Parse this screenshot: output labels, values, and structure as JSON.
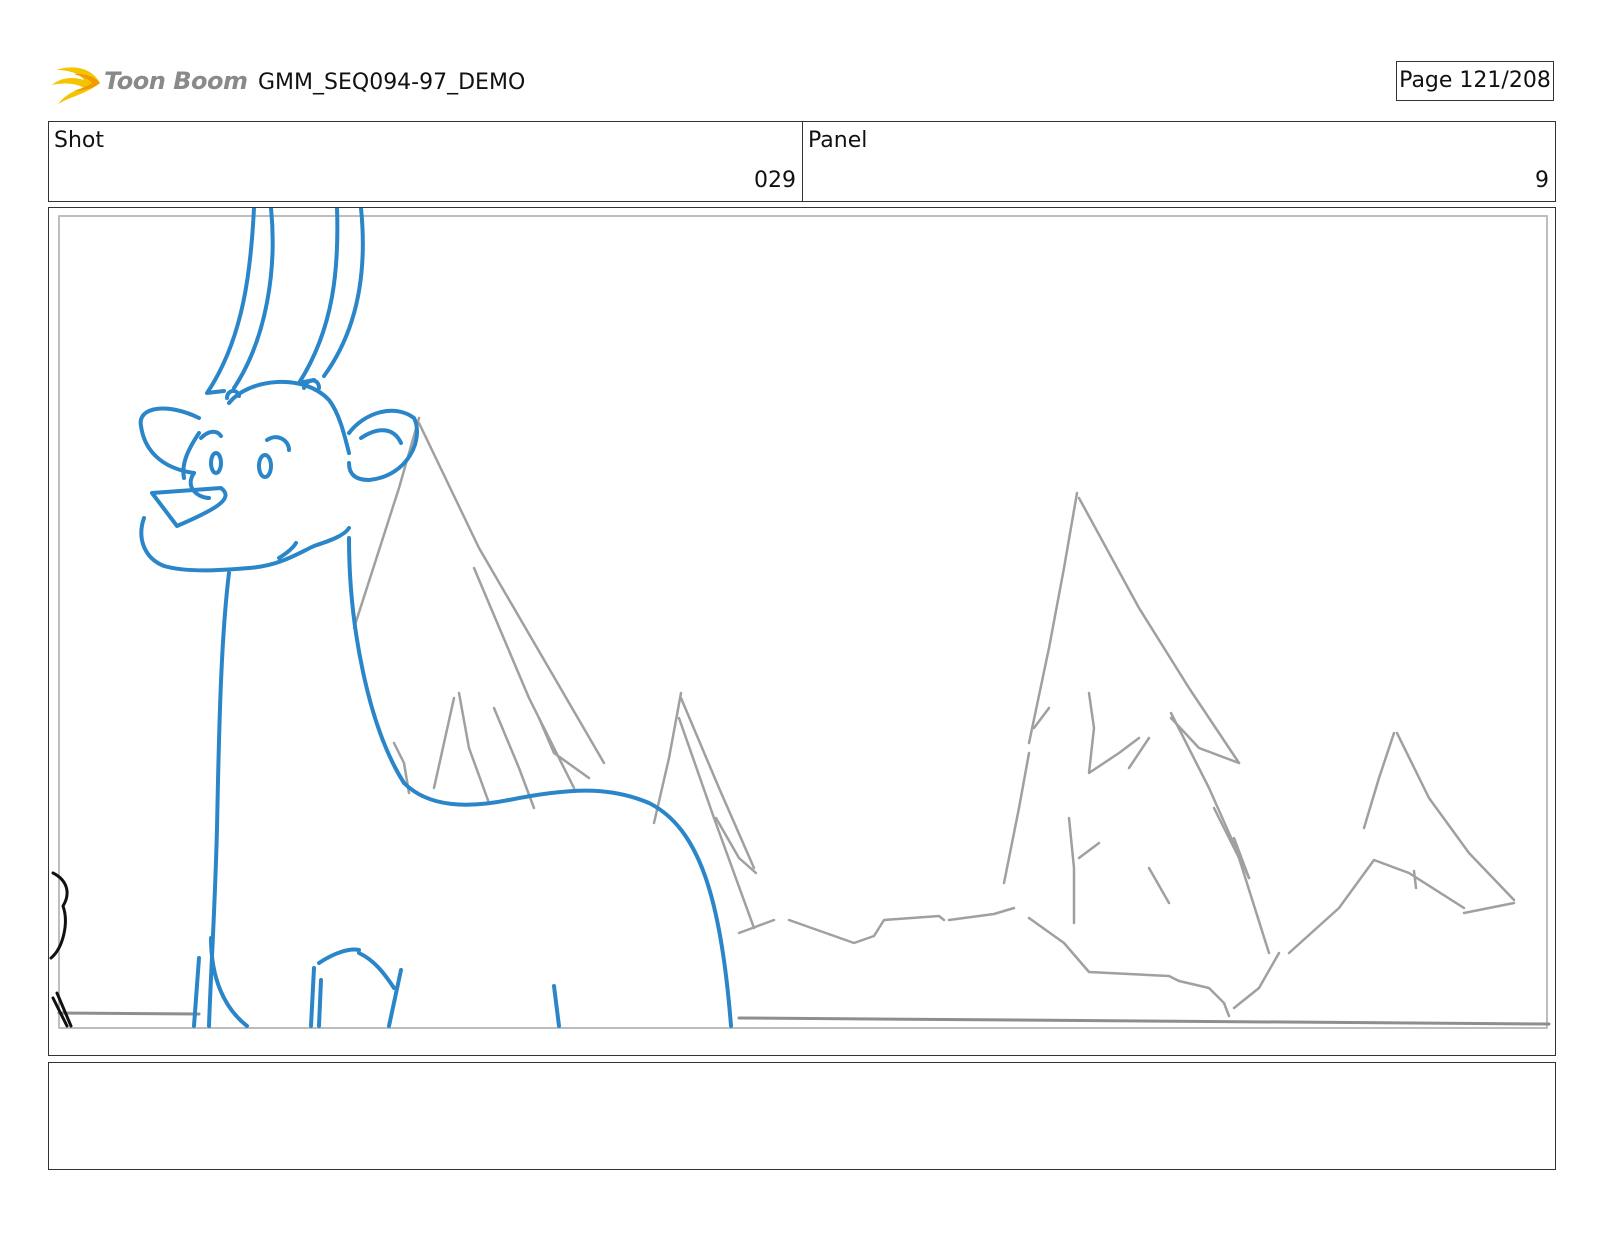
{
  "header": {
    "logo_text": "Toon Boom",
    "project_title": "GMM_SEQ094-97_DEMO",
    "page_label": "Page 121/208"
  },
  "shot": {
    "label": "Shot",
    "value": "029"
  },
  "panel": {
    "label": "Panel",
    "value": "9"
  },
  "notes": {
    "text": ""
  },
  "colors": {
    "character_line": "#2a86c8",
    "background_line": "#9c9c9c",
    "logo_yellow": "#f5c400",
    "border": "#333333"
  }
}
